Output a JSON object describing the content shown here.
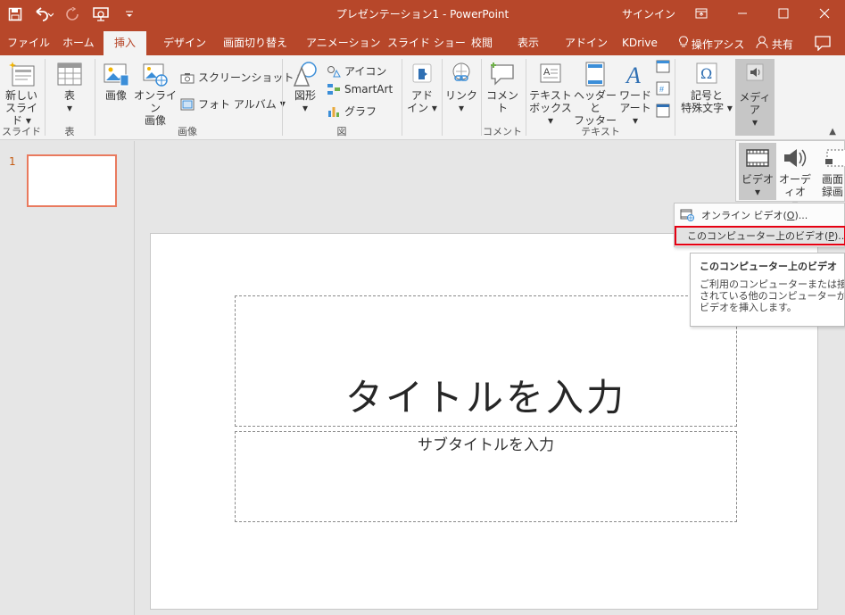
{
  "app": {
    "title": "プレゼンテーション1  -  PowerPoint",
    "signin": "サインイン",
    "accent": "#b7472a"
  },
  "qat": {
    "save_icon": "save-icon",
    "undo_icon": "undo-icon",
    "redo_icon": "redo-icon",
    "present_icon": "present-icon",
    "customize_icon": "customize-icon"
  },
  "tabs": [
    {
      "label": "ファイル"
    },
    {
      "label": "ホーム"
    },
    {
      "label": "挿入"
    },
    {
      "label": "デザイン"
    },
    {
      "label": "画面切り替え"
    },
    {
      "label": "アニメーション"
    },
    {
      "label": "スライド ショー"
    },
    {
      "label": "校閲"
    },
    {
      "label": "表示"
    },
    {
      "label": "アドイン"
    },
    {
      "label": "KDrive"
    }
  ],
  "tellme": "操作アシス",
  "share": "共有",
  "ribbon": {
    "new_slide": [
      "新しい",
      "スライド ▾"
    ],
    "grp_slides": "スライド",
    "table": [
      "表",
      "▾"
    ],
    "grp_table": "表",
    "pictures": "画像",
    "online_pictures": [
      "オンライン",
      "画像"
    ],
    "screenshot": "スクリーンショット",
    "photo_album": "フォト アルバム",
    "grp_images": "画像",
    "shapes": [
      "図形",
      "▾"
    ],
    "icons": "アイコン",
    "smartart": "SmartArt",
    "chart": "グラフ",
    "grp_illustrations": "図",
    "addins": [
      "アド",
      "イン ▾"
    ],
    "links": [
      "リンク",
      "▾"
    ],
    "comment": "コメント",
    "grp_comments": "コメント",
    "textbox": [
      "テキスト",
      "ボックス ▾"
    ],
    "header_footer": [
      "ヘッダーと",
      "フッター"
    ],
    "wordart": [
      "ワード",
      "アート ▾"
    ],
    "grp_text": "テキスト",
    "symbols": [
      "記号と",
      "特殊文字 ▾"
    ],
    "media": [
      "メディア",
      "▾"
    ]
  },
  "media_drop": {
    "video": [
      "ビデオ",
      "▾"
    ],
    "audio": [
      "オーディオ",
      "▾"
    ],
    "screen": [
      "画面",
      "録画"
    ]
  },
  "video_menu": {
    "online_pre": "オンライン ビデオ(",
    "online_key": "O",
    "online_post": ")...",
    "computer_pre": "このコンピューター上のビデオ(",
    "computer_key": "P",
    "computer_post": ")..."
  },
  "tooltip": {
    "title": "このコンピューター上のビデオ",
    "body": "ご利用のコンピューターまたは接続されている他のコンピューターからビデオを挿入します。"
  },
  "slides_pane": {
    "number": "1"
  },
  "slide": {
    "title_placeholder": "タイトルを入力",
    "subtitle_placeholder": "サブタイトルを入力"
  }
}
